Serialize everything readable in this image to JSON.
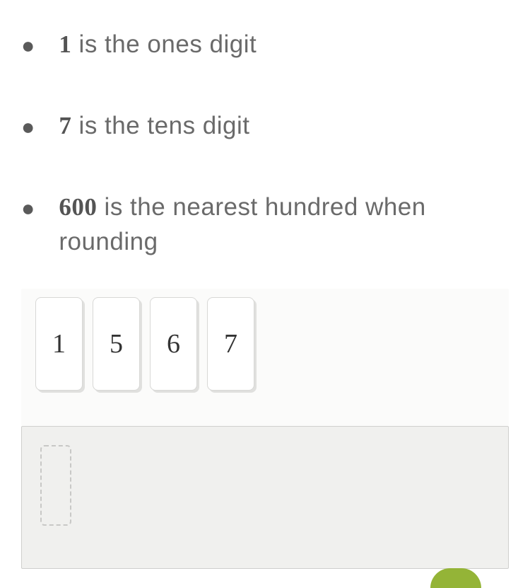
{
  "clues": [
    {
      "number": "1",
      "text": " is the ones digit"
    },
    {
      "number": "7",
      "text": " is the tens digit"
    },
    {
      "number": "600",
      "text": " is the nearest hundred when rounding"
    }
  ],
  "tiles": [
    "1",
    "5",
    "6",
    "7"
  ],
  "colors": {
    "accent": "#94b437"
  }
}
